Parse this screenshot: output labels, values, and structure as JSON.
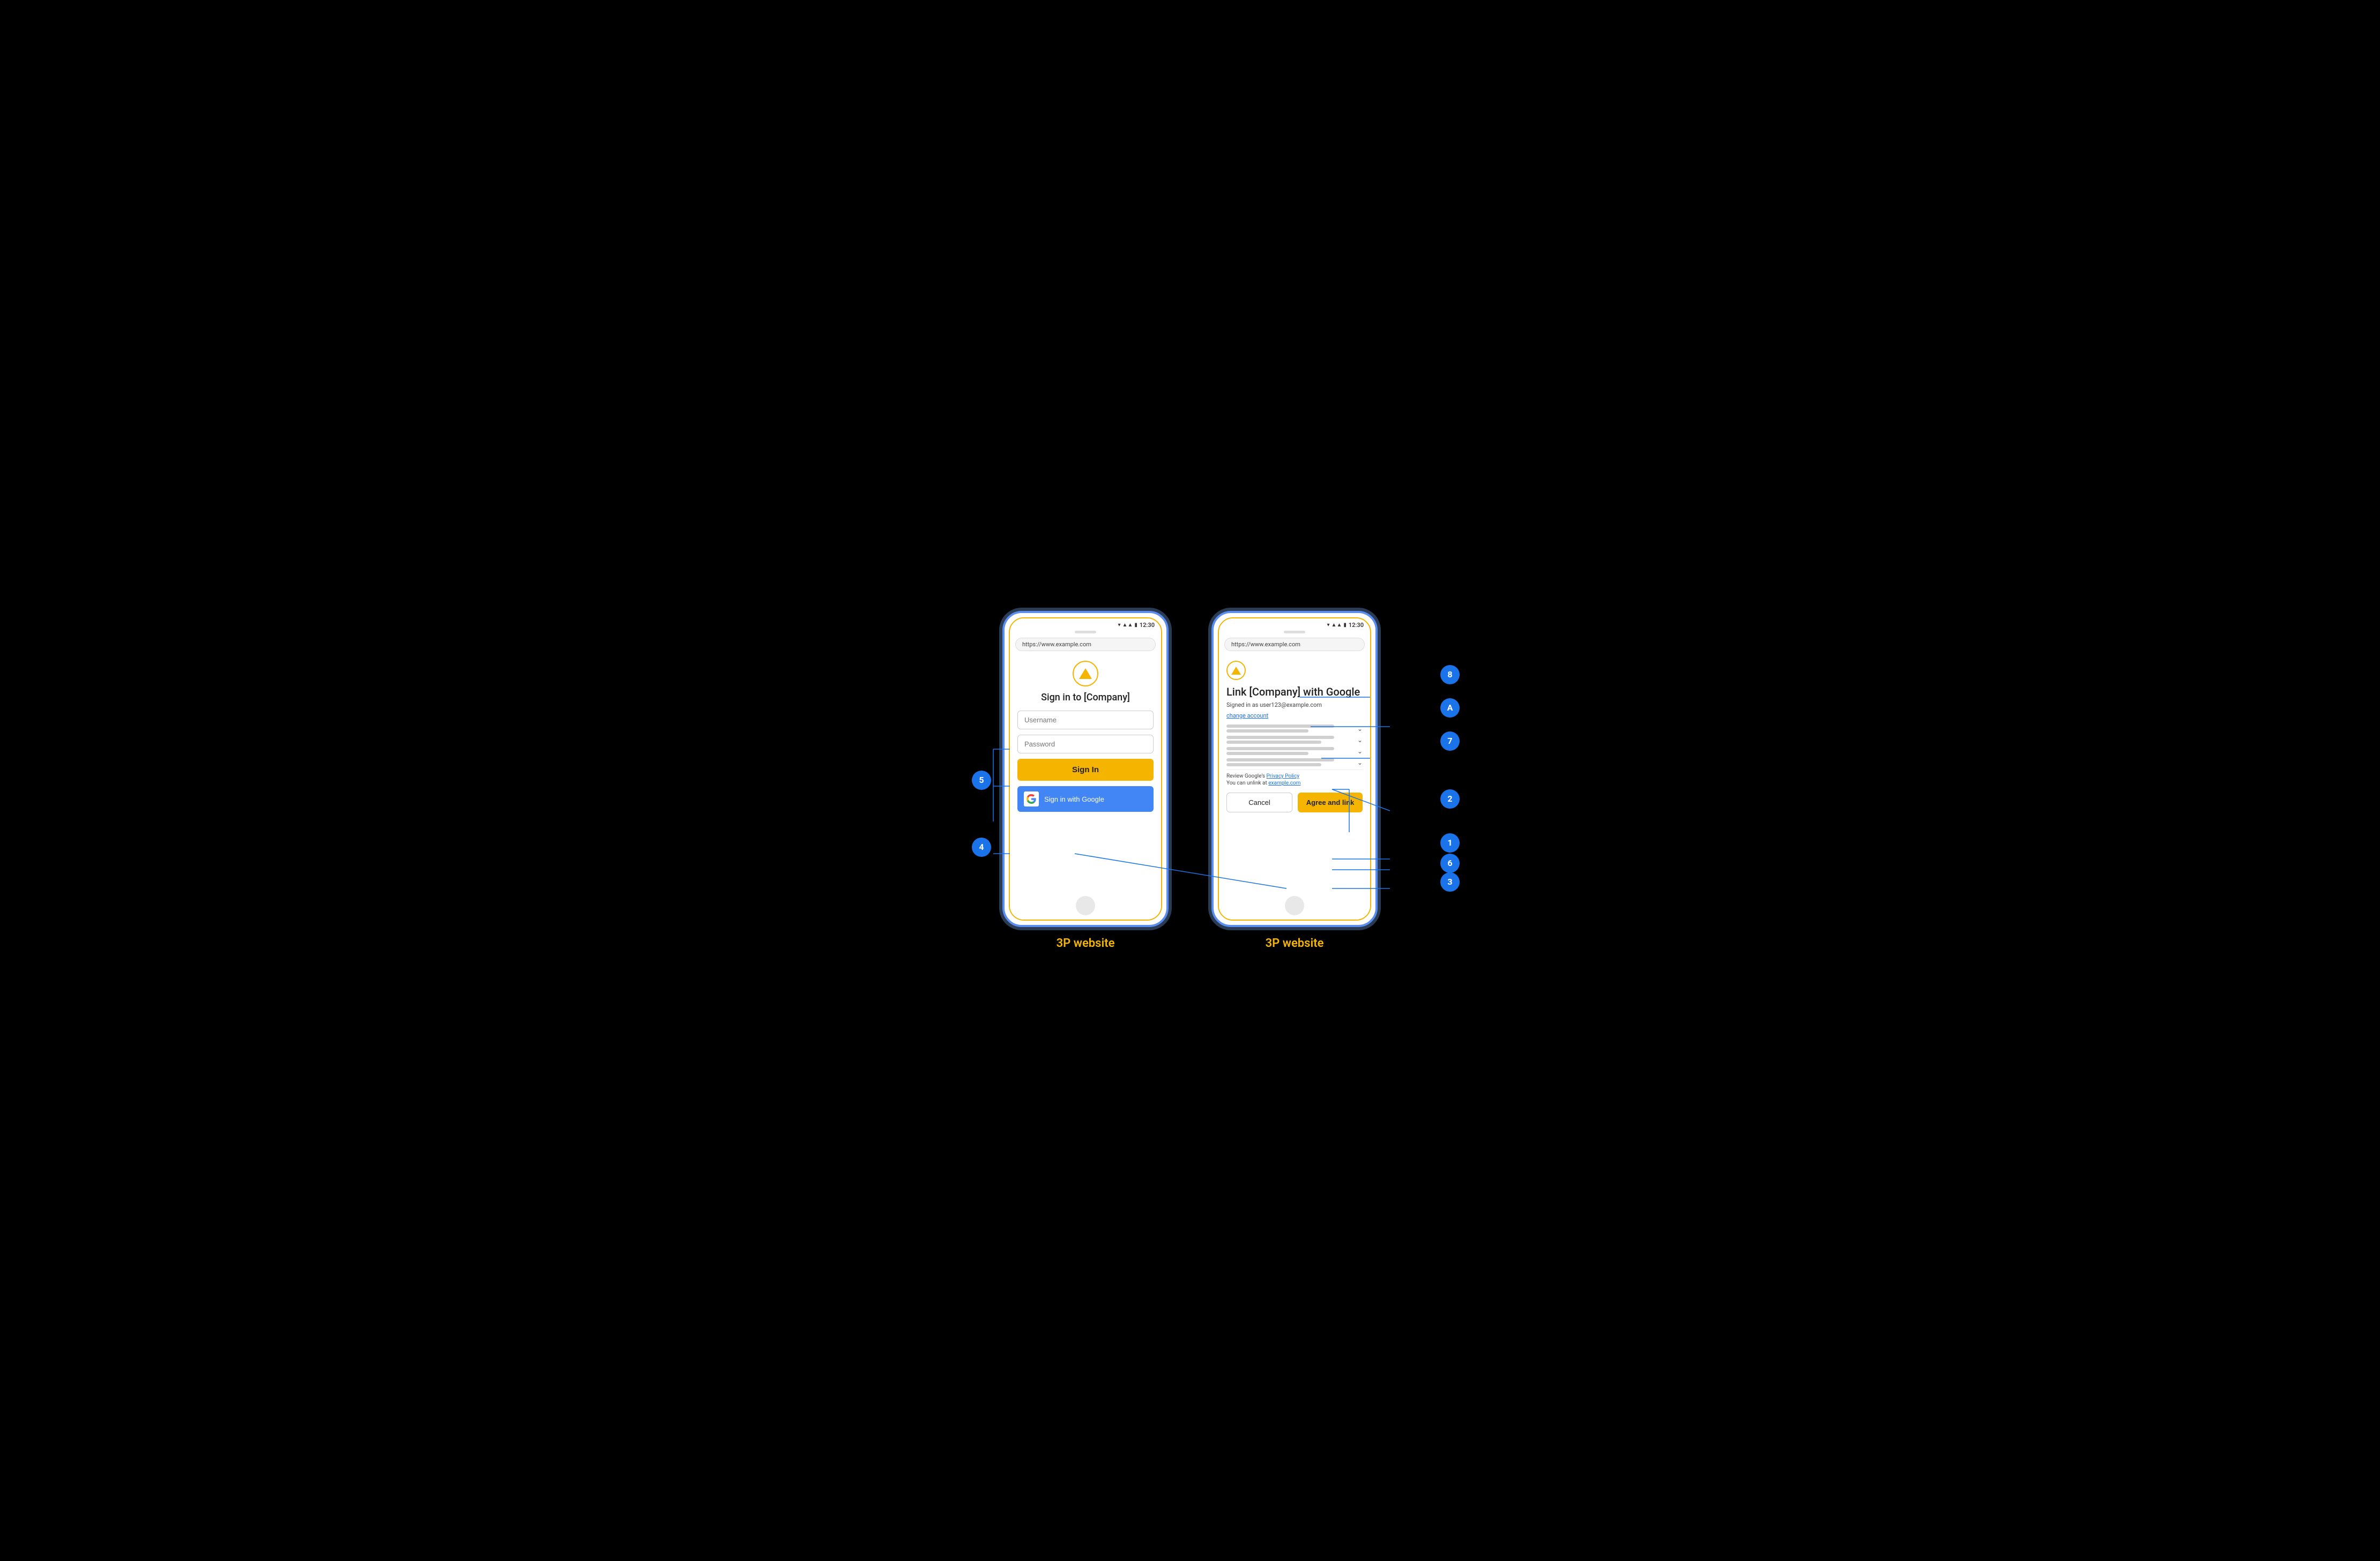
{
  "diagram": {
    "background": "#000000"
  },
  "left_phone": {
    "label": "3P website",
    "status_bar": {
      "time": "12:30"
    },
    "url": "https://www.example.com",
    "logo_alt": "Company logo triangle",
    "title": "Sign in to [Company]",
    "username_placeholder": "Username",
    "password_placeholder": "Password",
    "signin_button": "Sign In",
    "google_button": "Sign in with Google"
  },
  "right_phone": {
    "label": "3P website",
    "status_bar": {
      "time": "12:30"
    },
    "url": "https://www.example.com",
    "logo_alt": "Company logo triangle",
    "title": "Link [Company] with Google",
    "signed_in_as": "Signed in as user123@example.com",
    "change_account": "change account",
    "permissions": [
      {
        "lines": 2,
        "expandable": true
      },
      {
        "lines": 2,
        "expandable": true
      },
      {
        "lines": 2,
        "expandable": true
      },
      {
        "lines": 2,
        "expandable": true
      }
    ],
    "privacy_text": "Review Google's ",
    "privacy_link": "Privacy Policy",
    "unlink_text": "You can unlink at ",
    "unlink_link": "example.com",
    "cancel_button": "Cancel",
    "agree_button": "Agree and link"
  },
  "annotations": {
    "bubbles": [
      {
        "id": "1",
        "label": "1"
      },
      {
        "id": "2",
        "label": "2"
      },
      {
        "id": "3",
        "label": "3"
      },
      {
        "id": "4",
        "label": "4"
      },
      {
        "id": "5",
        "label": "5"
      },
      {
        "id": "6",
        "label": "6"
      },
      {
        "id": "7",
        "label": "7"
      },
      {
        "id": "8",
        "label": "8"
      },
      {
        "id": "A",
        "label": "A"
      }
    ]
  },
  "colors": {
    "blue": "#1a73e8",
    "phone_border": "#5B8DEF",
    "content_border": "#F4B400",
    "yellow": "#F4B400",
    "google_blue": "#4285F4"
  }
}
